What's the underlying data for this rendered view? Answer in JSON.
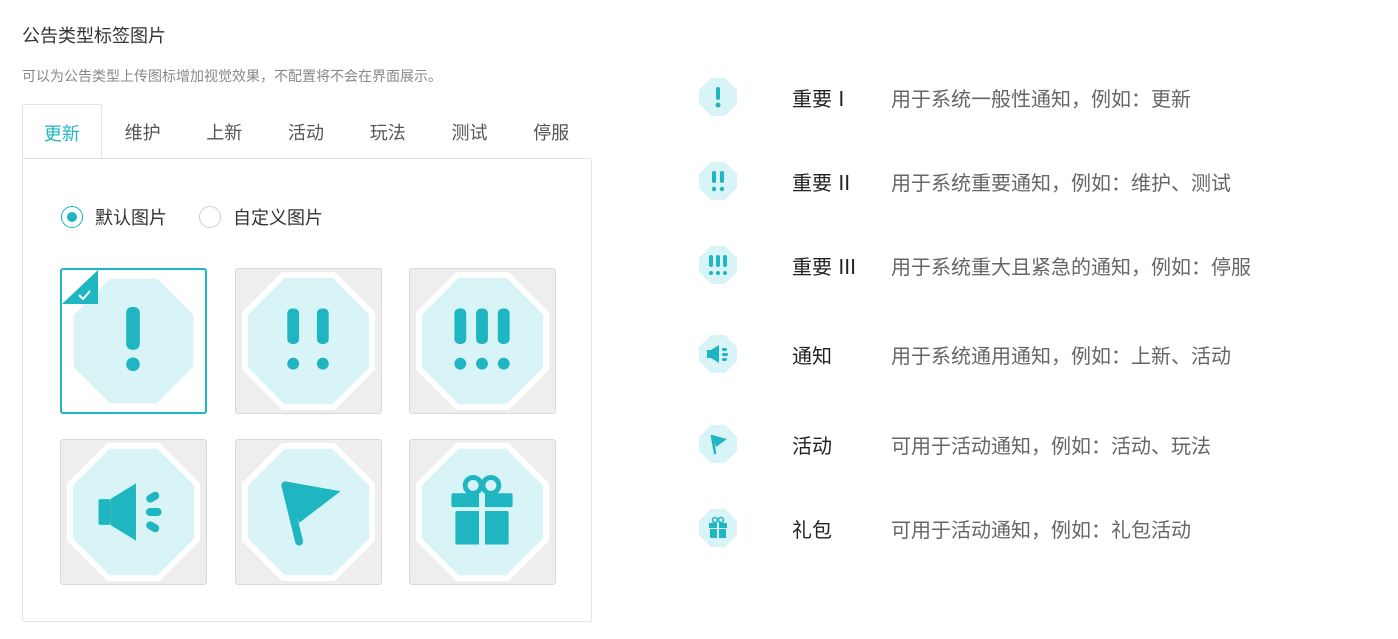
{
  "header": {
    "title": "公告类型标签图片",
    "description": "可以为公告类型上传图标增加视觉效果，不配置将不会在界面展示。"
  },
  "tabs": [
    {
      "label": "更新",
      "active": true
    },
    {
      "label": "维护",
      "active": false
    },
    {
      "label": "上新",
      "active": false
    },
    {
      "label": "活动",
      "active": false
    },
    {
      "label": "玩法",
      "active": false
    },
    {
      "label": "测试",
      "active": false
    },
    {
      "label": "停服",
      "active": false
    }
  ],
  "image_source": {
    "options": [
      {
        "label": "默认图片",
        "checked": true
      },
      {
        "label": "自定义图片",
        "checked": false
      }
    ]
  },
  "tiles": [
    {
      "icon": "exclamation-single-icon",
      "selected": true
    },
    {
      "icon": "exclamation-double-icon",
      "selected": false
    },
    {
      "icon": "exclamation-triple-icon",
      "selected": false
    },
    {
      "icon": "megaphone-icon",
      "selected": false
    },
    {
      "icon": "flag-icon",
      "selected": false
    },
    {
      "icon": "gift-icon",
      "selected": false
    }
  ],
  "legend": [
    {
      "icon": "exclamation-single-icon",
      "name": "重要 I",
      "desc": "用于系统一般性通知，例如：更新"
    },
    {
      "icon": "exclamation-double-icon",
      "name": "重要 II",
      "desc": "用于系统重要通知，例如：维护、测试"
    },
    {
      "icon": "exclamation-triple-icon",
      "name": "重要 III",
      "desc": "用于系统重大且紧急的通知，例如：停服"
    },
    {
      "icon": "megaphone-icon",
      "name": "通知",
      "desc": "用于系统通用通知，例如：上新、活动"
    },
    {
      "icon": "flag-icon",
      "name": "活动",
      "desc": "可用于活动通知，例如：活动、玩法"
    },
    {
      "icon": "gift-icon",
      "name": "礼包",
      "desc": "可用于活动通知，例如：礼包活动"
    }
  ],
  "colors": {
    "accent": "#1fb6c1",
    "icon_bg": "#d9f4f7",
    "tile_bg": "#eeeeee"
  }
}
